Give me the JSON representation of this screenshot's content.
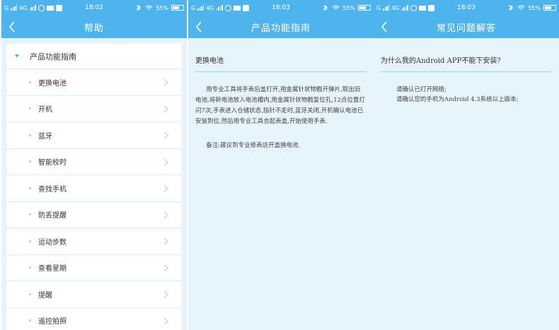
{
  "status_bar": {
    "network_left": "G",
    "network_4g": "4G",
    "battery": "55%",
    "times": [
      "18:02",
      "18:03",
      "18:03"
    ]
  },
  "screen1": {
    "title": "帮助",
    "group_label": "产品功能指南",
    "items": [
      {
        "label": "更换电池"
      },
      {
        "label": "开机"
      },
      {
        "label": "蓝牙"
      },
      {
        "label": "智能校时"
      },
      {
        "label": "查找手机"
      },
      {
        "label": "防丢提醒"
      },
      {
        "label": "运动步数"
      },
      {
        "label": "查看星期"
      },
      {
        "label": "提醒"
      },
      {
        "label": "遥控拍照"
      }
    ]
  },
  "screen2": {
    "title": "产品功能指南",
    "section_title": "更换电池",
    "paragraph": "用专业工具将手表后盖打开,用金属针状物戳开弹片,取出旧电池,将新电池放入电池槽内,用金属针状物戳复位孔,12点位置灯闪7次,手表进入仓储状态,指针不走时,蓝牙关闭,开机确认电池已安装到位,然后用专业工具合起表盖,开始使用手表.",
    "note": "备注:建议到专业修表店开盖换电池."
  },
  "screen3": {
    "title": "常见问题解答",
    "question": "为什么我的Android APP不能下安装?",
    "answer_line1": "请确认已打开网络;",
    "answer_line2": "请确认您的手机为Android 4.3系统以上版本;"
  },
  "colors": {
    "accent": "#50b4ec",
    "background": "#e6f3fb",
    "row_bg": "#ffffff",
    "divider": "#a8d4ee"
  },
  "icons": {
    "back": "back-arrow-icon",
    "chevron": "chevron-right-icon",
    "group_expand": "triangle-down-icon"
  }
}
